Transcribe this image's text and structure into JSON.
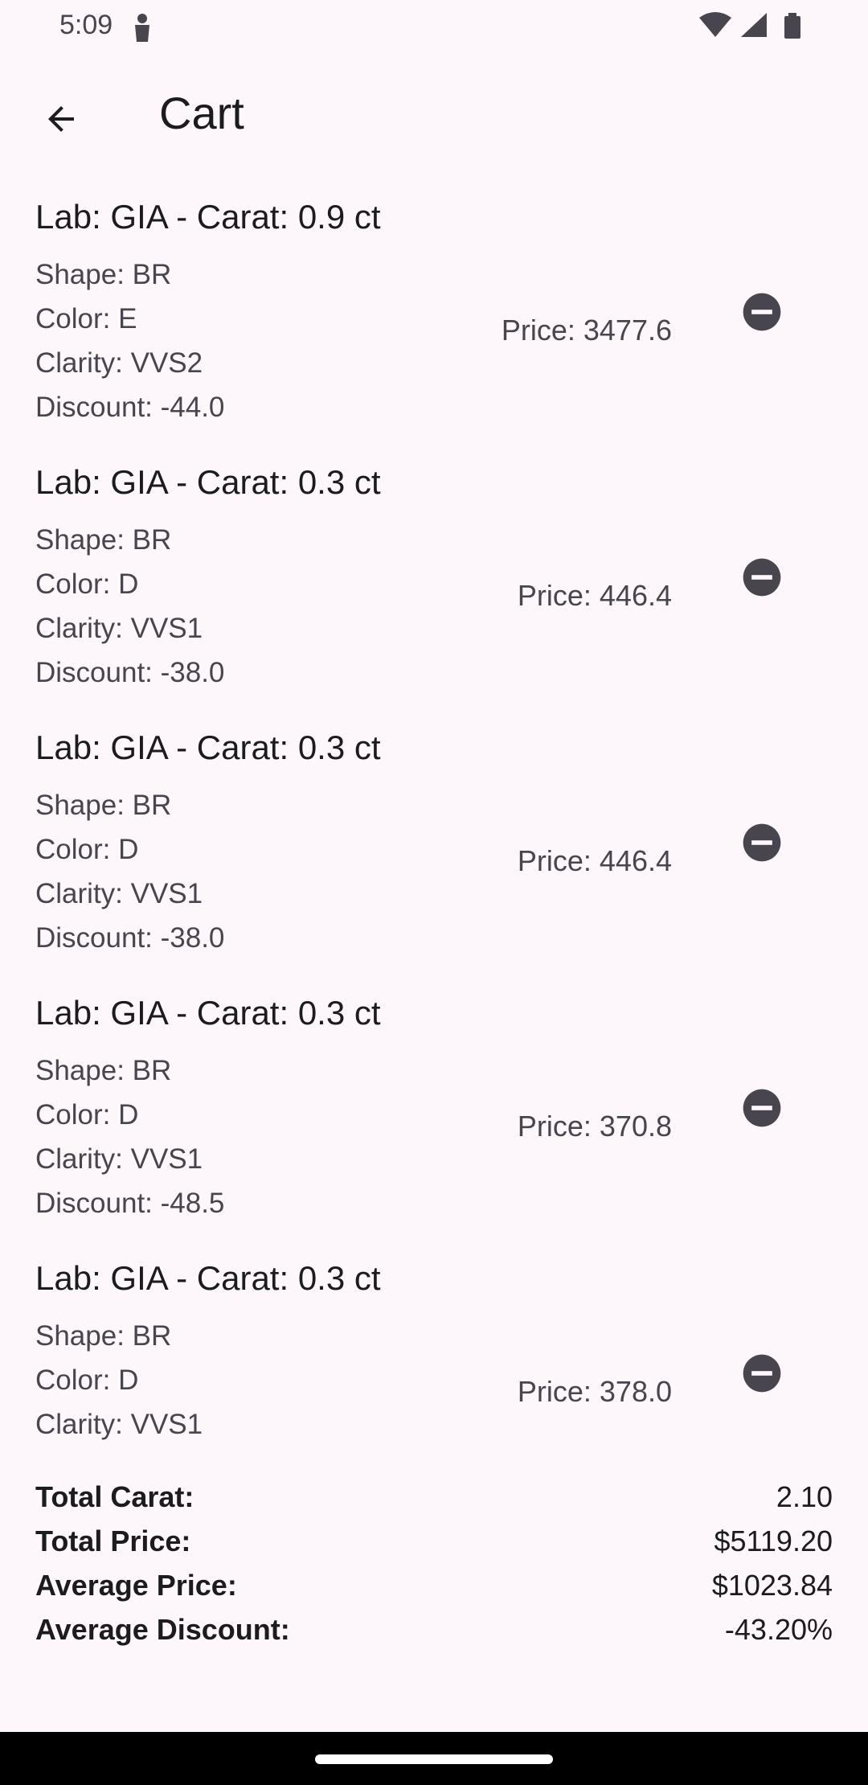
{
  "status_bar": {
    "time": "5:09",
    "icons": [
      "person-icon",
      "wifi-icon",
      "signal-icon",
      "battery-icon"
    ]
  },
  "app_bar": {
    "back_icon": "arrow-back-icon",
    "title": "Cart"
  },
  "items": [
    {
      "title": "Lab: GIA - Carat: 0.9 ct",
      "shape": "Shape: BR",
      "color": "Color: E",
      "clarity": "Clarity: VVS2",
      "discount": "Discount: -44.0",
      "price": "Price: 3477.6"
    },
    {
      "title": "Lab: GIA - Carat: 0.3 ct",
      "shape": "Shape: BR",
      "color": "Color: D",
      "clarity": "Clarity: VVS1",
      "discount": "Discount: -38.0",
      "price": "Price: 446.4"
    },
    {
      "title": "Lab: GIA - Carat: 0.3 ct",
      "shape": "Shape: BR",
      "color": "Color: D",
      "clarity": "Clarity: VVS1",
      "discount": "Discount: -38.0",
      "price": "Price: 446.4"
    },
    {
      "title": "Lab: GIA - Carat: 0.3 ct",
      "shape": "Shape: BR",
      "color": "Color: D",
      "clarity": "Clarity: VVS1",
      "discount": "Discount: -48.5",
      "price": "Price: 370.8"
    },
    {
      "title": "Lab: GIA - Carat: 0.3 ct",
      "shape": "Shape: BR",
      "color": "Color: D",
      "clarity": "Clarity: VVS1",
      "discount": "",
      "price": "Price: 378.0"
    }
  ],
  "summary": {
    "total_carat_label": "Total Carat:",
    "total_carat": "2.10",
    "total_price_label": "Total Price:",
    "total_price": "$5119.20",
    "average_price_label": "Average Price:",
    "average_price": "$1023.84",
    "average_discount_label": "Average Discount:",
    "average_discount": "-43.20%"
  },
  "colors": {
    "background": "#fdf7fb",
    "remove_icon": "#49454f",
    "text_primary": "#1c1b1f",
    "text_secondary": "#49454f"
  }
}
